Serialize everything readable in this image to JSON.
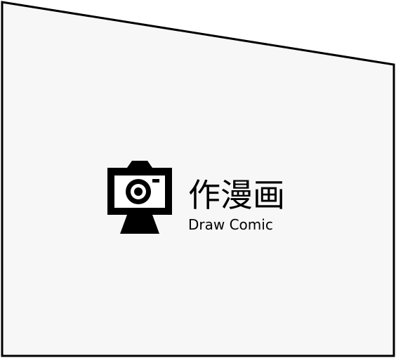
{
  "logo": {
    "icon": "camera-on-tripod-icon",
    "title_cn": "作漫画",
    "title_en": "Draw Comic"
  },
  "colors": {
    "panel_fill": "#f7f7f7",
    "panel_border": "#000000",
    "logo_color": "#000000"
  }
}
